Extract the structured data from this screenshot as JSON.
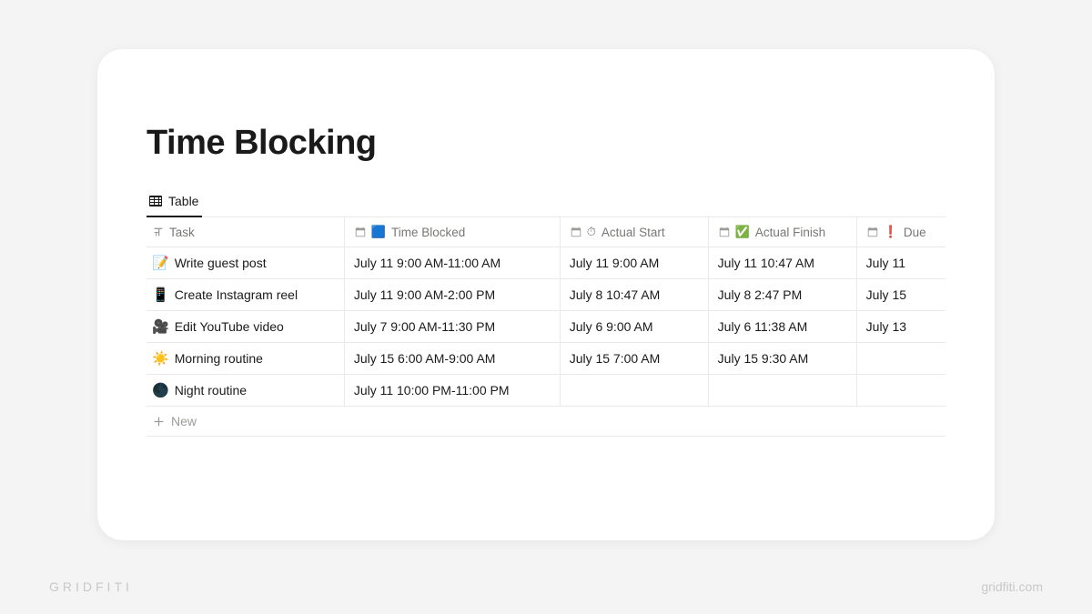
{
  "page_title": "Time Blocking",
  "tab_label": "Table",
  "columns": {
    "task": "Task",
    "time_blocked": "Time Blocked",
    "time_blocked_emoji": "🟦",
    "actual_start": "Actual Start",
    "actual_start_emoji": "⏱",
    "actual_finish": "Actual Finish",
    "actual_finish_emoji": "✅",
    "due": "Due",
    "due_emoji": "❗"
  },
  "rows": [
    {
      "emoji": "📝",
      "task": "Write guest post",
      "blocked": "July 11  9:00 AM-11:00 AM",
      "start": "July 11  9:00 AM",
      "finish": "July 11 10:47 AM",
      "due": "July 11"
    },
    {
      "emoji": "📱",
      "task": "Create Instagram reel",
      "blocked": "July 11  9:00 AM-2:00 PM",
      "start": "July 8  10:47 AM",
      "finish": "July 8 2:47 PM",
      "due": "July 15"
    },
    {
      "emoji": "🎥",
      "task": "Edit YouTube video",
      "blocked": "July 7  9:00 AM-11:30 PM",
      "start": "July 6  9:00 AM",
      "finish": "July 6 11:38 AM",
      "due": "July 13"
    },
    {
      "emoji": "☀️",
      "task": "Morning routine",
      "blocked": "July 15  6:00 AM-9:00 AM",
      "start": "July 15  7:00 AM",
      "finish": "July 15 9:30 AM",
      "due": ""
    },
    {
      "emoji": "🌑",
      "task": "Night routine",
      "blocked": "July 11  10:00 PM-11:00 PM",
      "start": "",
      "finish": "",
      "due": ""
    }
  ],
  "new_label": "New",
  "footer_left": "GRIDFITI",
  "footer_right": "gridfiti.com"
}
